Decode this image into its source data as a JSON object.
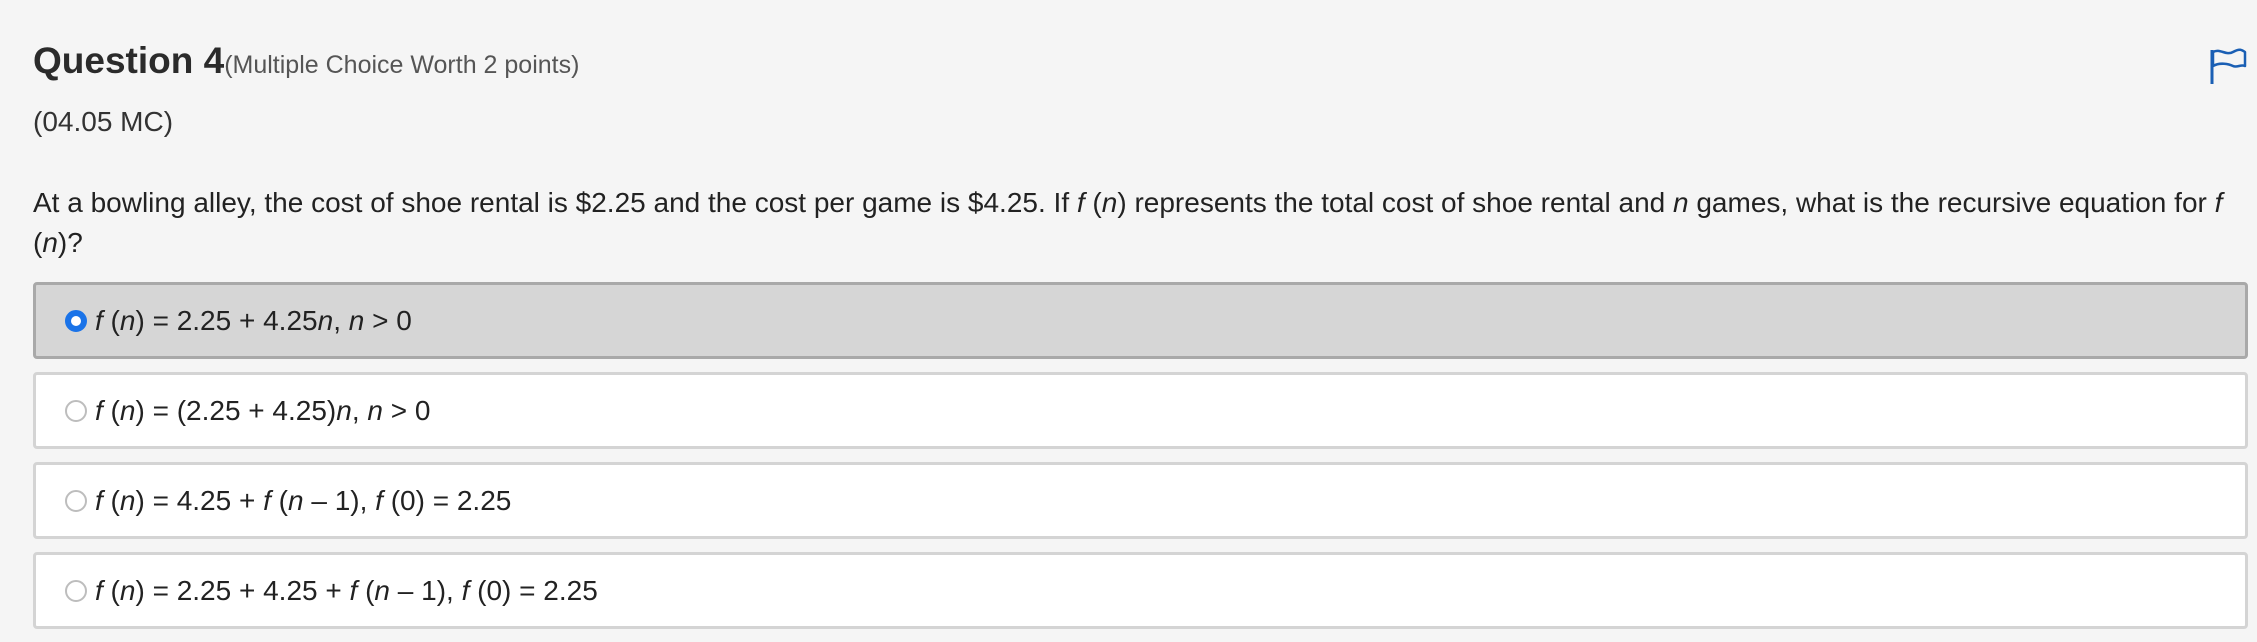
{
  "question": {
    "title": "Question 4",
    "worth": "(Multiple Choice Worth 2 points)",
    "code": "(04.05 MC)",
    "stem_parts": [
      {
        "text": "At a bowling alley, the cost of shoe rental is $2.25 and the cost per game is $4.25. If ",
        "italic": false
      },
      {
        "text": "f",
        "italic": true
      },
      {
        "text": " (",
        "italic": false
      },
      {
        "text": "n",
        "italic": true
      },
      {
        "text": ") represents the total cost of shoe rental and ",
        "italic": false
      },
      {
        "text": "n",
        "italic": true
      },
      {
        "text": " games, what is the recursive equation for ",
        "italic": false
      },
      {
        "text": "f",
        "italic": true
      },
      {
        "text": " (",
        "italic": false
      },
      {
        "text": "n",
        "italic": true
      },
      {
        "text": ")?",
        "italic": false
      }
    ]
  },
  "flag": {
    "icon": "flag-icon",
    "color": "#1a5fb4"
  },
  "colors": {
    "radio_selected": "#1a73e8",
    "selected_background": "#d6d6d6",
    "page_background": "#f5f5f5"
  },
  "choices": [
    {
      "selected": true,
      "parts": [
        {
          "text": "f",
          "italic": true
        },
        {
          "text": " (",
          "italic": false
        },
        {
          "text": "n",
          "italic": true
        },
        {
          "text": ") = 2.25 + 4.25",
          "italic": false
        },
        {
          "text": "n",
          "italic": true
        },
        {
          "text": ", ",
          "italic": false
        },
        {
          "text": "n",
          "italic": true
        },
        {
          "text": " > 0",
          "italic": false
        }
      ]
    },
    {
      "selected": false,
      "parts": [
        {
          "text": "f",
          "italic": true
        },
        {
          "text": " (",
          "italic": false
        },
        {
          "text": "n",
          "italic": true
        },
        {
          "text": ") = (2.25 + 4.25)",
          "italic": false
        },
        {
          "text": "n",
          "italic": true
        },
        {
          "text": ", ",
          "italic": false
        },
        {
          "text": "n",
          "italic": true
        },
        {
          "text": " > 0",
          "italic": false
        }
      ]
    },
    {
      "selected": false,
      "parts": [
        {
          "text": "f",
          "italic": true
        },
        {
          "text": " (",
          "italic": false
        },
        {
          "text": "n",
          "italic": true
        },
        {
          "text": ") = 4.25 + ",
          "italic": false
        },
        {
          "text": "f",
          "italic": true
        },
        {
          "text": " (",
          "italic": false
        },
        {
          "text": "n",
          "italic": true
        },
        {
          "text": " – 1), ",
          "italic": false
        },
        {
          "text": "f",
          "italic": true
        },
        {
          "text": " (0) = 2.25",
          "italic": false
        }
      ]
    },
    {
      "selected": false,
      "parts": [
        {
          "text": "f",
          "italic": true
        },
        {
          "text": " (",
          "italic": false
        },
        {
          "text": "n",
          "italic": true
        },
        {
          "text": ") = 2.25 + 4.25 + ",
          "italic": false
        },
        {
          "text": "f",
          "italic": true
        },
        {
          "text": " (",
          "italic": false
        },
        {
          "text": "n",
          "italic": true
        },
        {
          "text": " – 1), ",
          "italic": false
        },
        {
          "text": "f",
          "italic": true
        },
        {
          "text": " (0) = 2.25",
          "italic": false
        }
      ]
    }
  ]
}
